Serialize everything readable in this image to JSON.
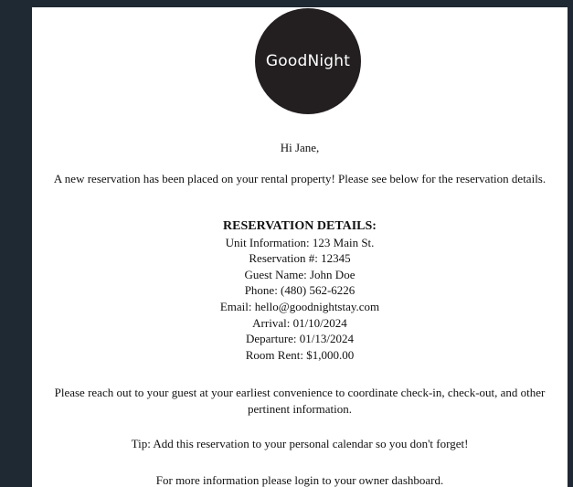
{
  "logo": {
    "text": "GoodNight"
  },
  "greeting": "Hi Jane,",
  "intro": "A new reservation has been placed on your rental property! Please see below for the reservation details.",
  "details": {
    "title": "RESERVATION DETAILS:",
    "rows": [
      "Unit Information: 123 Main St.",
      "Reservation #: 12345",
      "Guest Name: John Doe",
      "Phone: (480) 562-6226",
      "Email: hello@goodnightstay.com",
      "Arrival: 01/10/2024",
      "Departure: 01/13/2024",
      "Room Rent: $1,000.00"
    ]
  },
  "reach_out": "Please reach out to your guest at your earliest convenience to coordinate check-in, check-out, and other pertinent information.",
  "tip": "Tip: Add this reservation to your personal calendar so you don't forget!",
  "more_info": "For more information please login to your owner dashboard."
}
